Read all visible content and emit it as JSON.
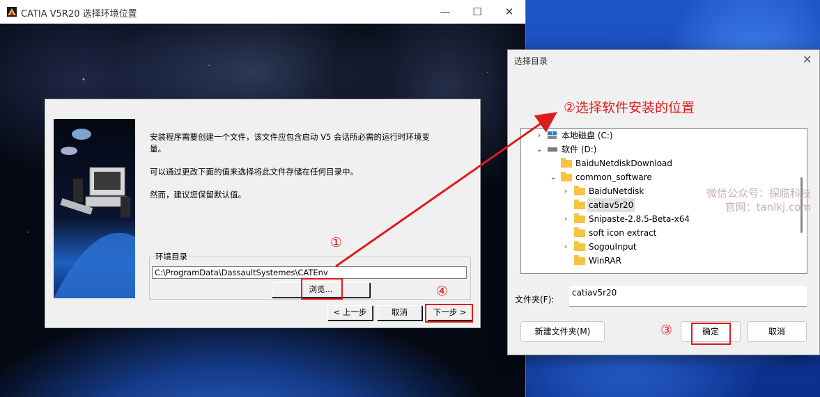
{
  "catia_window": {
    "title": "CATIA V5R20 选择环境位置",
    "controls": {
      "minimize": "—",
      "maximize": "☐",
      "close": "✕"
    }
  },
  "setup_dialog": {
    "paragraphs": [
      "安装程序需要创建一个文件，该文件应包含启动 V5 会话所必需的运行时环境变量。",
      "可以通过更改下面的值来选择将此文件存储在任何目录中。",
      "然而，建议您保留默认值。"
    ],
    "env_group_label": "环境目录",
    "env_path": "C:\\ProgramData\\DassaultSystemes\\CATEnv",
    "browse_label": "浏览...",
    "prev_label": "< 上一步",
    "cancel_label": "取消",
    "next_label": "下一步 >"
  },
  "folder_dialog": {
    "title": "选择目录",
    "close": "✕",
    "heading": "②选择软件安装的位置",
    "tree": [
      {
        "label": "本地磁盘 (C:)",
        "level": 1,
        "chevron": "›",
        "icon": "drive-icon"
      },
      {
        "label": "软件 (D:)",
        "level": 1,
        "chevron": "⌄",
        "icon": "drive-icon"
      },
      {
        "label": "BaiduNetdiskDownload",
        "level": 2,
        "chevron": "",
        "icon": "folder-icon"
      },
      {
        "label": "common_software",
        "level": 2,
        "chevron": "⌄",
        "icon": "folder-icon"
      },
      {
        "label": "BaiduNetdisk",
        "level": 3,
        "chevron": "›",
        "icon": "folder-icon"
      },
      {
        "label": "catiav5r20",
        "level": 3,
        "chevron": "",
        "icon": "folder-icon",
        "selected": true
      },
      {
        "label": "Snipaste-2.8.5-Beta-x64",
        "level": 3,
        "chevron": "›",
        "icon": "folder-icon"
      },
      {
        "label": "soft icon extract",
        "level": 3,
        "chevron": "",
        "icon": "folder-icon"
      },
      {
        "label": "SogouInput",
        "level": 3,
        "chevron": "›",
        "icon": "folder-icon"
      },
      {
        "label": "WinRAR",
        "level": 3,
        "chevron": "",
        "icon": "folder-icon"
      }
    ],
    "folder_label": "文件夹(F):",
    "folder_value": "catiav5r20",
    "new_folder_label": "新建文件夹(M)",
    "ok_label": "确定",
    "cancel_label": "取消"
  },
  "annotations": {
    "step1": "①",
    "step3": "③",
    "step4": "④",
    "color": "#e01b1b"
  },
  "watermark": {
    "line1": "微信公众号：探临科技",
    "line2": "官网：tanlkj.com"
  }
}
